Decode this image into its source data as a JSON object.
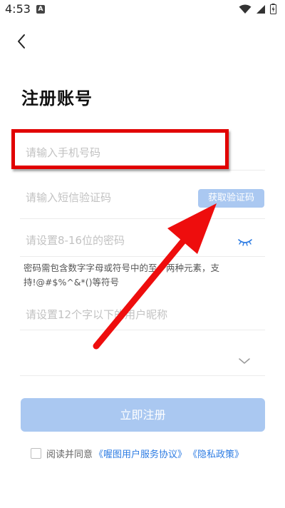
{
  "status_bar": {
    "time": "4:53",
    "app_badge": "A"
  },
  "page": {
    "title": "注册账号"
  },
  "form": {
    "phone_placeholder": "请输入手机号码",
    "sms_placeholder": "请输入短信验证码",
    "get_code_label": "获取验证码",
    "password_placeholder": "请设置8-16位的密码",
    "password_hint": "密码需包含数字字母或符号中的至少两种元素，支持!@#$%^&*()等符号",
    "nickname_placeholder": "请设置12个字以下的用户昵称",
    "select_value": ""
  },
  "actions": {
    "register_label": "立即注册"
  },
  "agreement": {
    "prefix": "阅读并同意",
    "service_link": "《喔图用户服务协议》",
    "privacy_link": "《隐私政策》"
  },
  "colors": {
    "primary_disabled": "#aac8f1",
    "link": "#2d7ce3",
    "annotation_red": "#e10000"
  },
  "icons": [
    "back-arrow-icon",
    "eye-closed-icon",
    "chevron-down-icon",
    "wifi-icon",
    "signal-icon",
    "battery-icon"
  ]
}
